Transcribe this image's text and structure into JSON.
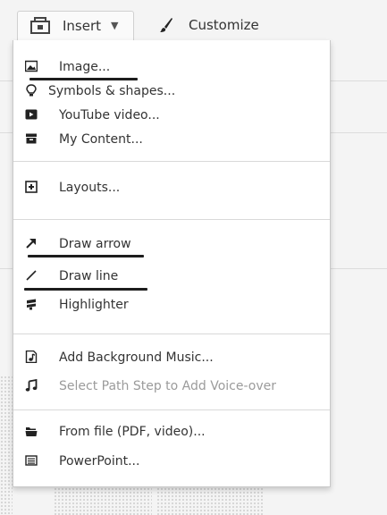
{
  "toolbar": {
    "insert_label": "Insert",
    "customize_label": "Customize"
  },
  "menu": {
    "items": [
      {
        "label": "Image...",
        "icon": "image-icon"
      },
      {
        "label": "Symbols & shapes...",
        "icon": "lightbulb-icon"
      },
      {
        "label": "YouTube video...",
        "icon": "youtube-play-icon"
      },
      {
        "label": "My Content...",
        "icon": "content-box-icon"
      },
      {
        "label": "Layouts...",
        "icon": "layouts-plus-icon"
      },
      {
        "label": "Draw arrow",
        "icon": "arrow-icon"
      },
      {
        "label": "Draw line",
        "icon": "line-icon"
      },
      {
        "label": "Highlighter",
        "icon": "highlighter-icon"
      },
      {
        "label": "Add Background Music...",
        "icon": "music-file-icon"
      },
      {
        "label": "Select Path Step to Add Voice-over",
        "icon": "music-note-icon",
        "disabled": true
      },
      {
        "label": "From file (PDF, video)...",
        "icon": "folder-icon"
      },
      {
        "label": "PowerPoint...",
        "icon": "powerpoint-icon"
      }
    ]
  },
  "colors": {
    "menu_bg": "#ffffff",
    "text": "#333333",
    "disabled_text": "#9b9b9b",
    "underline": "#1d1d1d"
  }
}
